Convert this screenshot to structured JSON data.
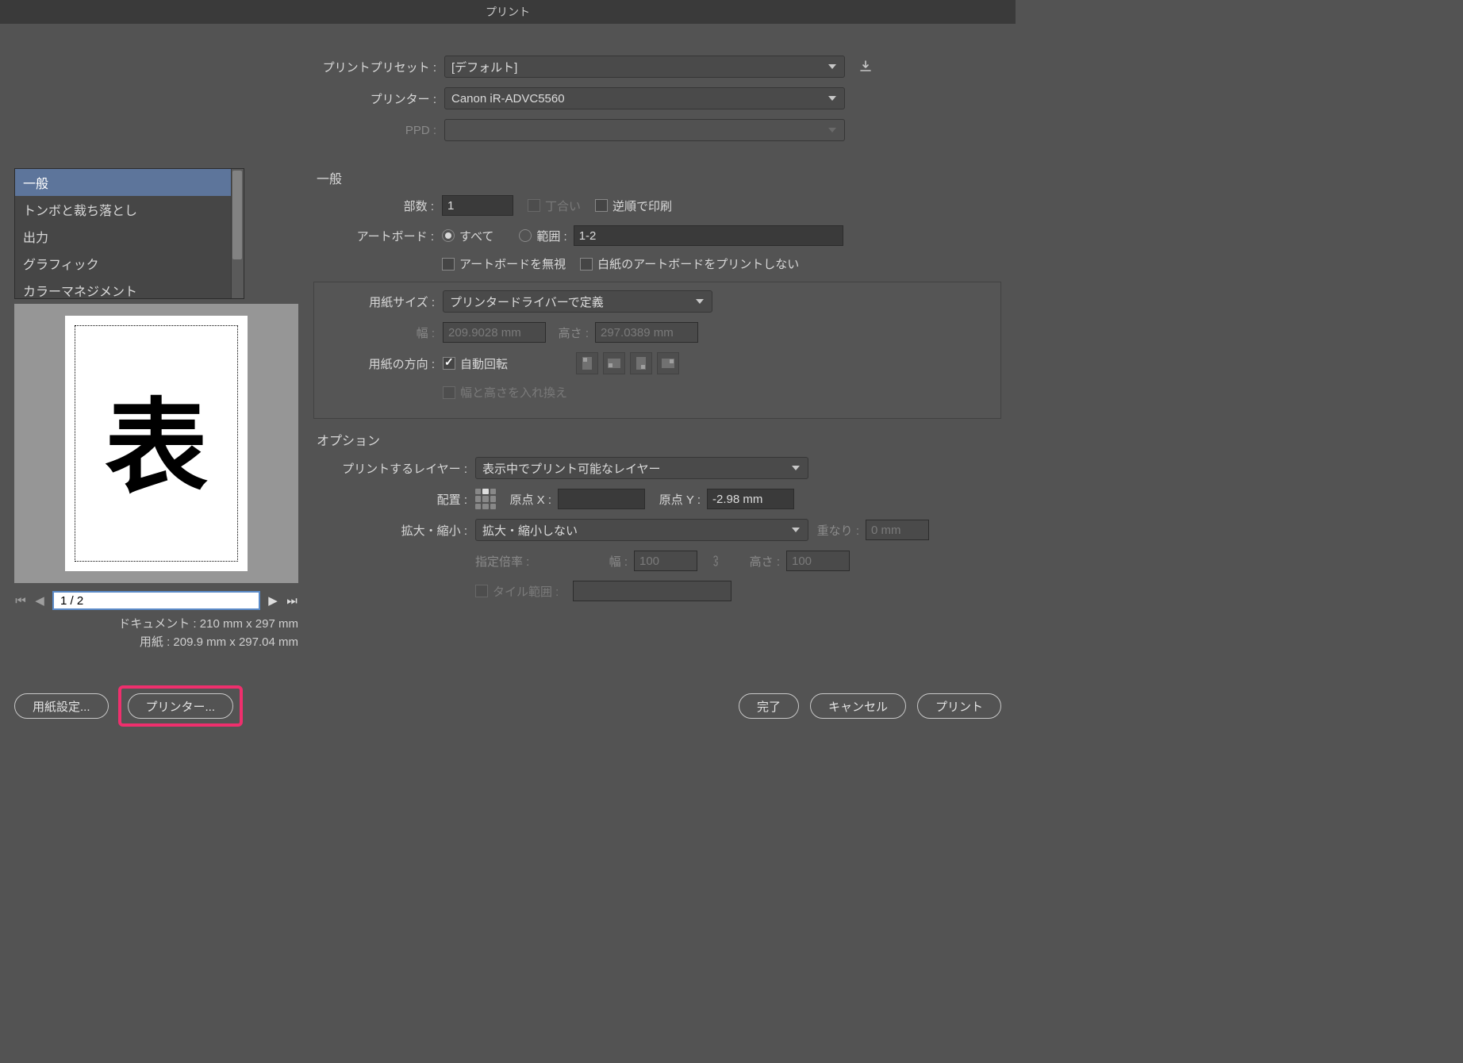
{
  "window": {
    "title": "プリント"
  },
  "top": {
    "preset_label": "プリントプリセット :",
    "preset_value": "[デフォルト]",
    "printer_label": "プリンター :",
    "printer_value": "Canon iR-ADVC5560",
    "ppd_label": "PPD :",
    "ppd_value": ""
  },
  "sidebar": {
    "items": [
      "一般",
      "トンボと裁ち落とし",
      "出力",
      "グラフィック",
      "カラーマネジメント"
    ],
    "selected_index": 0
  },
  "preview": {
    "glyph": "表",
    "page_indicator": "1 / 2",
    "doc_label": "ドキュメント :",
    "doc_value": "210 mm x 297 mm",
    "paper_label": "用紙 :",
    "paper_value": "209.9 mm x 297.04 mm"
  },
  "general": {
    "heading": "一般",
    "copies_label": "部数 :",
    "copies_value": "1",
    "collate_label": "丁合い",
    "reverse_label": "逆順で印刷",
    "artboard_label": "アートボード :",
    "all_label": "すべて",
    "range_label": "範囲 :",
    "range_value": "1-2",
    "ignore_ab_label": "アートボードを無視",
    "skip_blank_label": "白紙のアートボードをプリントしない",
    "paper_size_label": "用紙サイズ :",
    "paper_size_value": "プリンタードライバーで定義",
    "width_label": "幅 :",
    "width_value": "209.9028 mm",
    "height_label": "高さ :",
    "height_value": "297.0389 mm",
    "orientation_label": "用紙の方向 :",
    "auto_rotate_label": "自動回転",
    "swap_wh_label": "幅と高さを入れ換え"
  },
  "options": {
    "heading": "オプション",
    "layers_label": "プリントするレイヤー :",
    "layers_value": "表示中でプリント可能なレイヤー",
    "placement_label": "配置 :",
    "origin_x_label": "原点 X :",
    "origin_x_value": "",
    "origin_y_label": "原点 Y :",
    "origin_y_value": "-2.98 mm",
    "scaling_label": "拡大・縮小 :",
    "scaling_value": "拡大・縮小しない",
    "overlap_label": "重なり :",
    "overlap_value": "0 mm",
    "custom_scale_label": "指定倍率 :",
    "cs_width_label": "幅 :",
    "cs_width_value": "100",
    "cs_height_label": "高さ :",
    "cs_height_value": "100",
    "tile_range_label": "タイル範囲 :",
    "tile_range_value": ""
  },
  "buttons": {
    "paper_setup": "用紙設定...",
    "printer": "プリンター...",
    "done": "完了",
    "cancel": "キャンセル",
    "print": "プリント"
  }
}
